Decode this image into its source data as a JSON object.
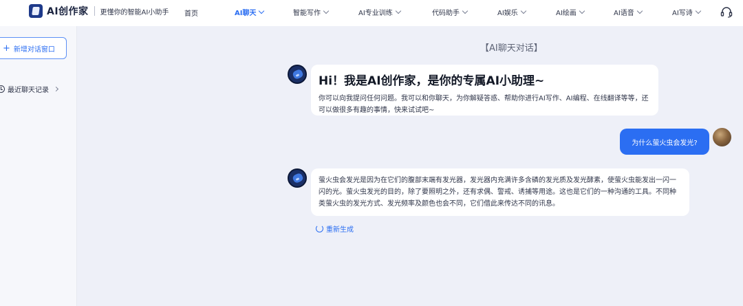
{
  "header": {
    "logo_text": "AI创作家",
    "slogan": "更懂你的智能AI小助手",
    "home_label": "首页",
    "nav_items": [
      {
        "label": "AI聊天",
        "active": true
      },
      {
        "label": "智能写作",
        "active": false
      },
      {
        "label": "AI专业训练",
        "active": false
      },
      {
        "label": "代码助手",
        "active": false
      },
      {
        "label": "AI娱乐",
        "active": false
      },
      {
        "label": "AI绘画",
        "active": false
      },
      {
        "label": "AI语音",
        "active": false
      },
      {
        "label": "AI写诗",
        "active": false
      }
    ],
    "support_icon": "headset-icon"
  },
  "sidebar": {
    "new_chat_label": "新增对话窗口",
    "history_label": "最近聊天记录"
  },
  "chat": {
    "title": "【AI聊天对话】",
    "greeting_title": "Hi！我是AI创作家，是你的专属AI小助理~",
    "greeting_body": "你可以向我提问任何问题。我可以和你聊天，为你解疑答惑、帮助你进行AI写作、AI编程、在线翻译等等，还可以做很多有趣的事情，快来试试吧~",
    "user_question": "为什么萤火虫会发光?",
    "answer": "萤火虫会发光是因为在它们的腹部末端有发光器，发光器内充满许多含磷的发光质及发光酵素，使萤火虫能发出一闪一闪的光。萤火虫发光的目的，除了要照明之外，还有求偶、警戒、诱捕等用途。这也是它们的一种沟通的工具。不同种类萤火虫的发光方式、发光频率及颜色也会不同，它们借此来传达不同的讯息。",
    "regenerate_label": "重新生成"
  },
  "colors": {
    "accent": "#2b6ef2",
    "page_background": "#eef0f8"
  }
}
